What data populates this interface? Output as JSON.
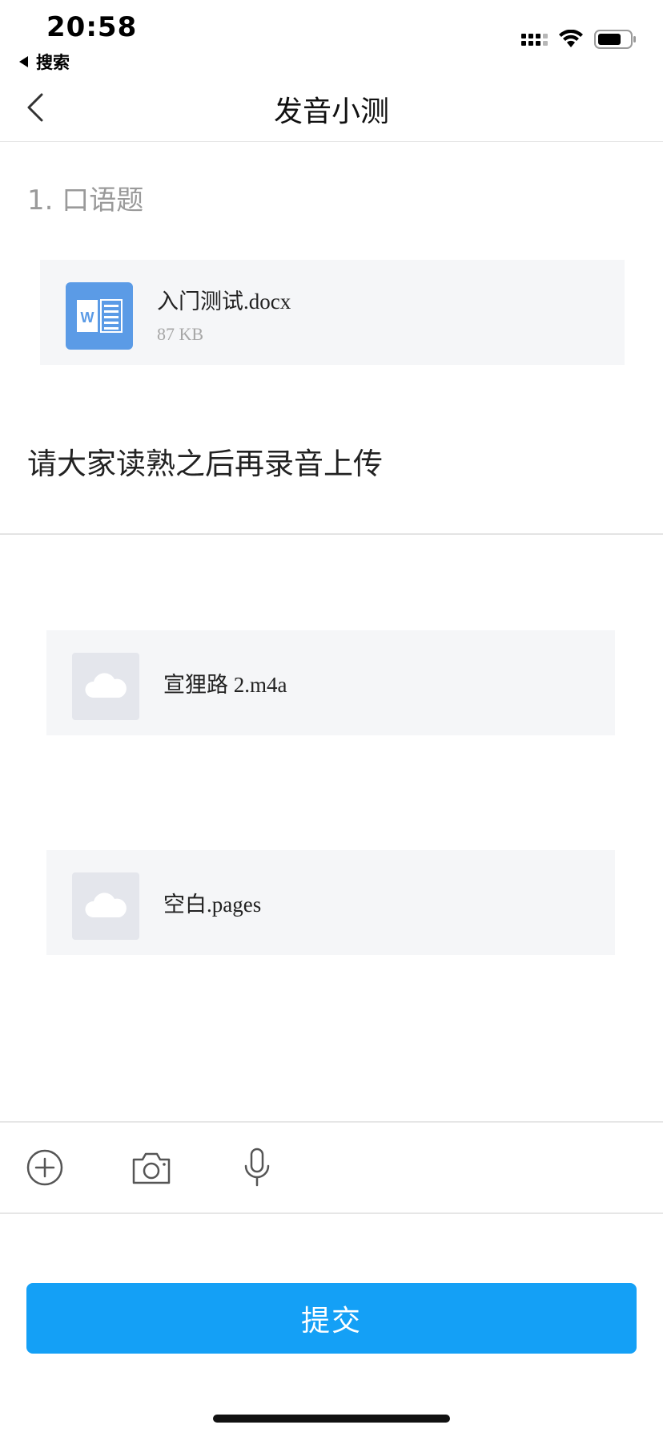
{
  "status_bar": {
    "time": "20:58",
    "back_app_label": "搜索",
    "icons": [
      "cellular-signal-icon",
      "wifi-icon",
      "battery-icon"
    ]
  },
  "nav": {
    "title": "发音小测",
    "back_icon": "chevron-left-icon"
  },
  "question": {
    "label": "1. 口语题",
    "attachment": {
      "name": "入门测试.docx",
      "size": "87 KB",
      "icon": "word-doc-icon"
    },
    "instruction": "请大家读熟之后再录音上传"
  },
  "uploads": [
    {
      "name": "宣狸路 2.m4a",
      "icon": "cloud-icon"
    },
    {
      "name": "空白.pages",
      "icon": "cloud-icon"
    }
  ],
  "toolbar": {
    "icons": [
      "add-icon",
      "camera-icon",
      "microphone-icon"
    ]
  },
  "submit_label": "提交",
  "colors": {
    "accent": "#14a0f6",
    "word_blue": "#5b9be6",
    "card_bg": "#f5f6f8"
  }
}
